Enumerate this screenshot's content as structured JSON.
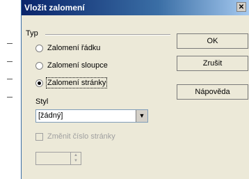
{
  "dialog": {
    "title": "Vložit zalomení"
  },
  "typ": {
    "label": "Typ",
    "options": [
      {
        "label": "Zalomení řádku",
        "checked": false
      },
      {
        "label": "Zalomení sloupce",
        "checked": false
      },
      {
        "label": "Zalomení stránky",
        "checked": true
      }
    ]
  },
  "styl": {
    "label": "Styl",
    "value": "[žádný]"
  },
  "page_number": {
    "label": "Změnit číslo stránky",
    "enabled": false,
    "value": ""
  },
  "buttons": {
    "ok": "OK",
    "cancel": "Zrušit",
    "help": "Nápověda"
  }
}
